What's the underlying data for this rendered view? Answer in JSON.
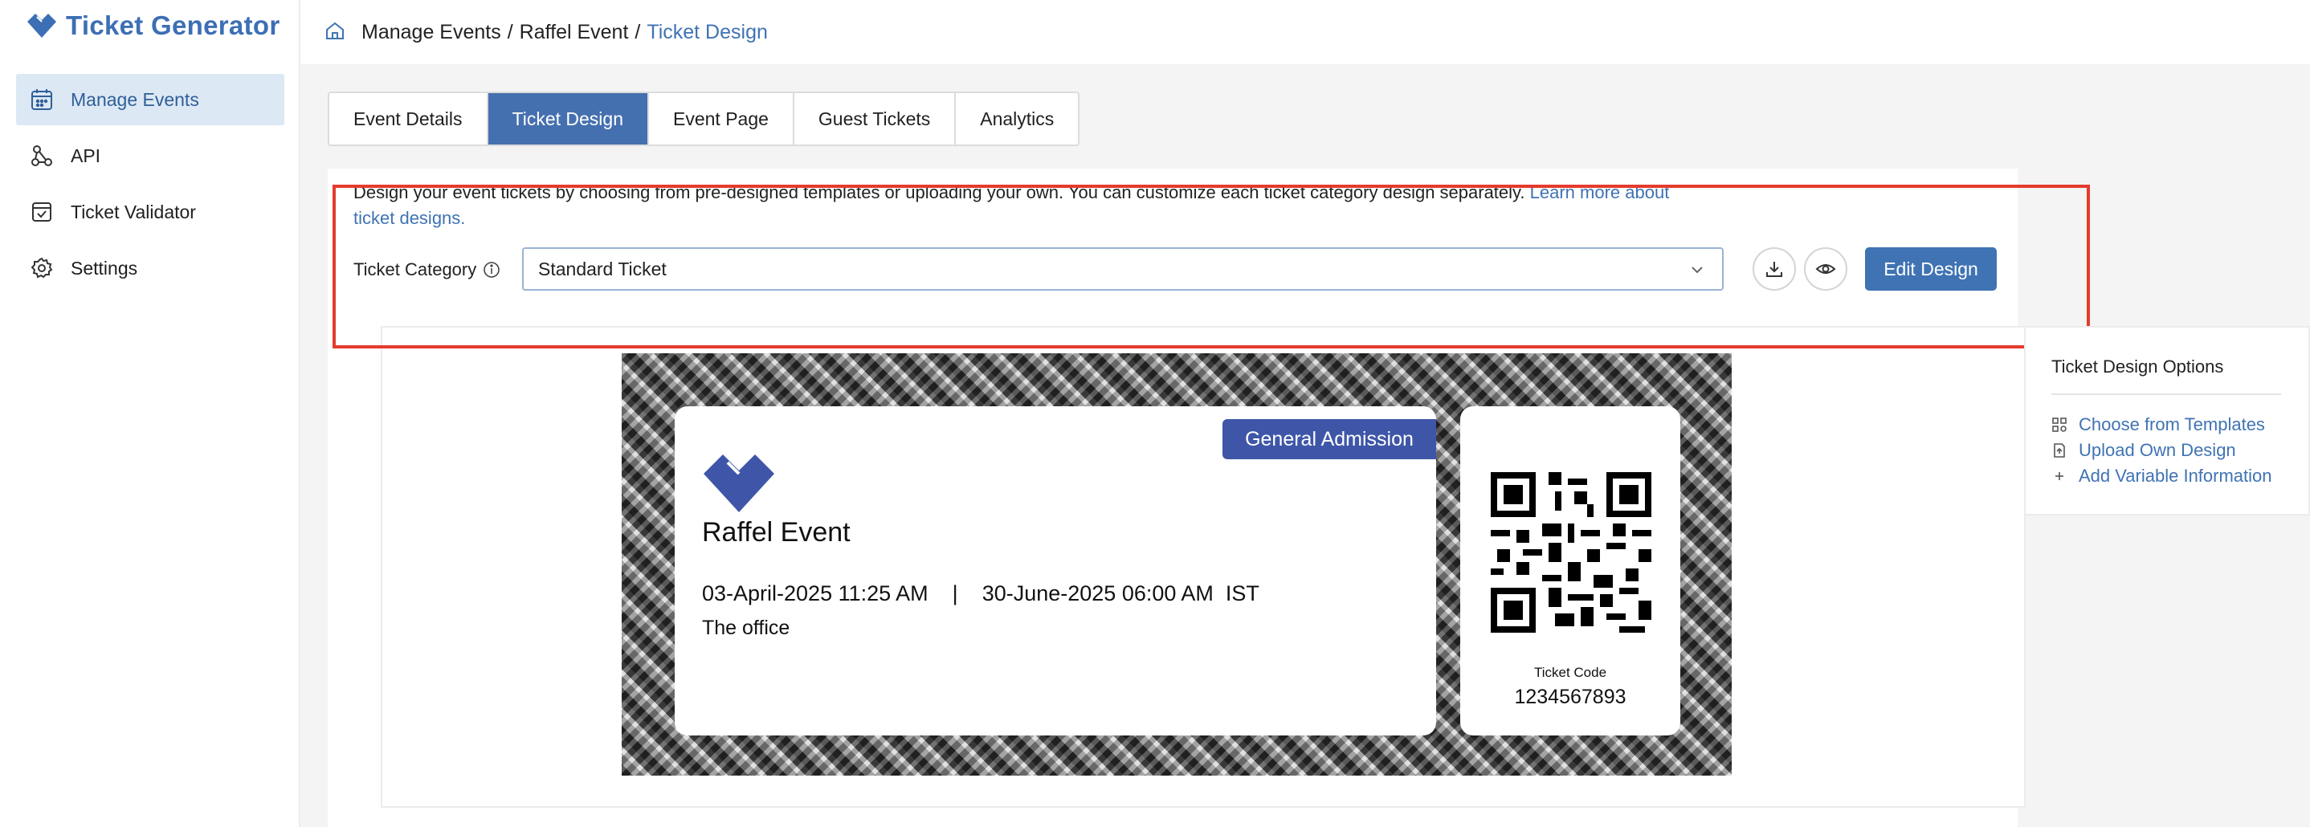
{
  "app": {
    "name": "Ticket Generator"
  },
  "sidebar": {
    "items": [
      {
        "label": "Manage Events",
        "icon": "calendar-icon",
        "active": true
      },
      {
        "label": "API",
        "icon": "api-nodes-icon"
      },
      {
        "label": "Ticket Validator",
        "icon": "ticket-check-icon"
      },
      {
        "label": "Settings",
        "icon": "gear-icon"
      }
    ]
  },
  "breadcrumb": {
    "part1": "Manage Events",
    "sep1": "/",
    "part2": "Raffel Event",
    "sep2": "/",
    "current": "Ticket Design"
  },
  "tabs": [
    {
      "label": "Event Details"
    },
    {
      "label": "Ticket Design",
      "active": true
    },
    {
      "label": "Event Page"
    },
    {
      "label": "Guest Tickets"
    },
    {
      "label": "Analytics"
    }
  ],
  "description": {
    "text": "Design your event tickets by choosing from pre-designed templates or uploading your own. You can customize each ticket category design separately. ",
    "link": "Learn more about ticket designs."
  },
  "category": {
    "label": "Ticket Category",
    "selected": "Standard Ticket"
  },
  "actions": {
    "edit_label": "Edit Design"
  },
  "ticket": {
    "badge": "General Admission",
    "title": "Raffel Event",
    "dates": "03-April-2025 11:25 AM    |    30-June-2025 06:00 AM  IST",
    "venue": "The office",
    "code_label": "Ticket Code",
    "code": "1234567893"
  },
  "options": {
    "title": "Ticket Design Options",
    "items": [
      {
        "label": "Choose from Templates",
        "icon": "template-icon"
      },
      {
        "label": "Upload Own Design",
        "icon": "upload-file-icon"
      },
      {
        "label": "Add Variable Information",
        "icon": "plus-icon"
      }
    ]
  },
  "colors": {
    "accent": "#3f73b3",
    "badge": "#3f56a8",
    "highlight": "#e53b2c",
    "active_nav_bg": "#dce8f4"
  }
}
